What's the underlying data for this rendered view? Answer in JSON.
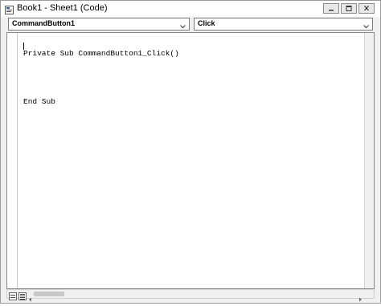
{
  "window": {
    "title": "Book1 - Sheet1 (Code)",
    "app_icon": "vba-code-icon"
  },
  "object_combo": {
    "value": "CommandButton1"
  },
  "procedure_combo": {
    "value": "Click"
  },
  "code": {
    "lines": [
      "Private Sub CommandButton1_Click()",
      "",
      "End Sub"
    ]
  },
  "icons": {
    "minimize": "minimize-icon",
    "maximize": "maximize-icon",
    "close": "close-icon",
    "dropdown": "chevron-down-icon",
    "procedure_view": "procedure-view-icon",
    "full_module_view": "full-module-view-icon"
  }
}
